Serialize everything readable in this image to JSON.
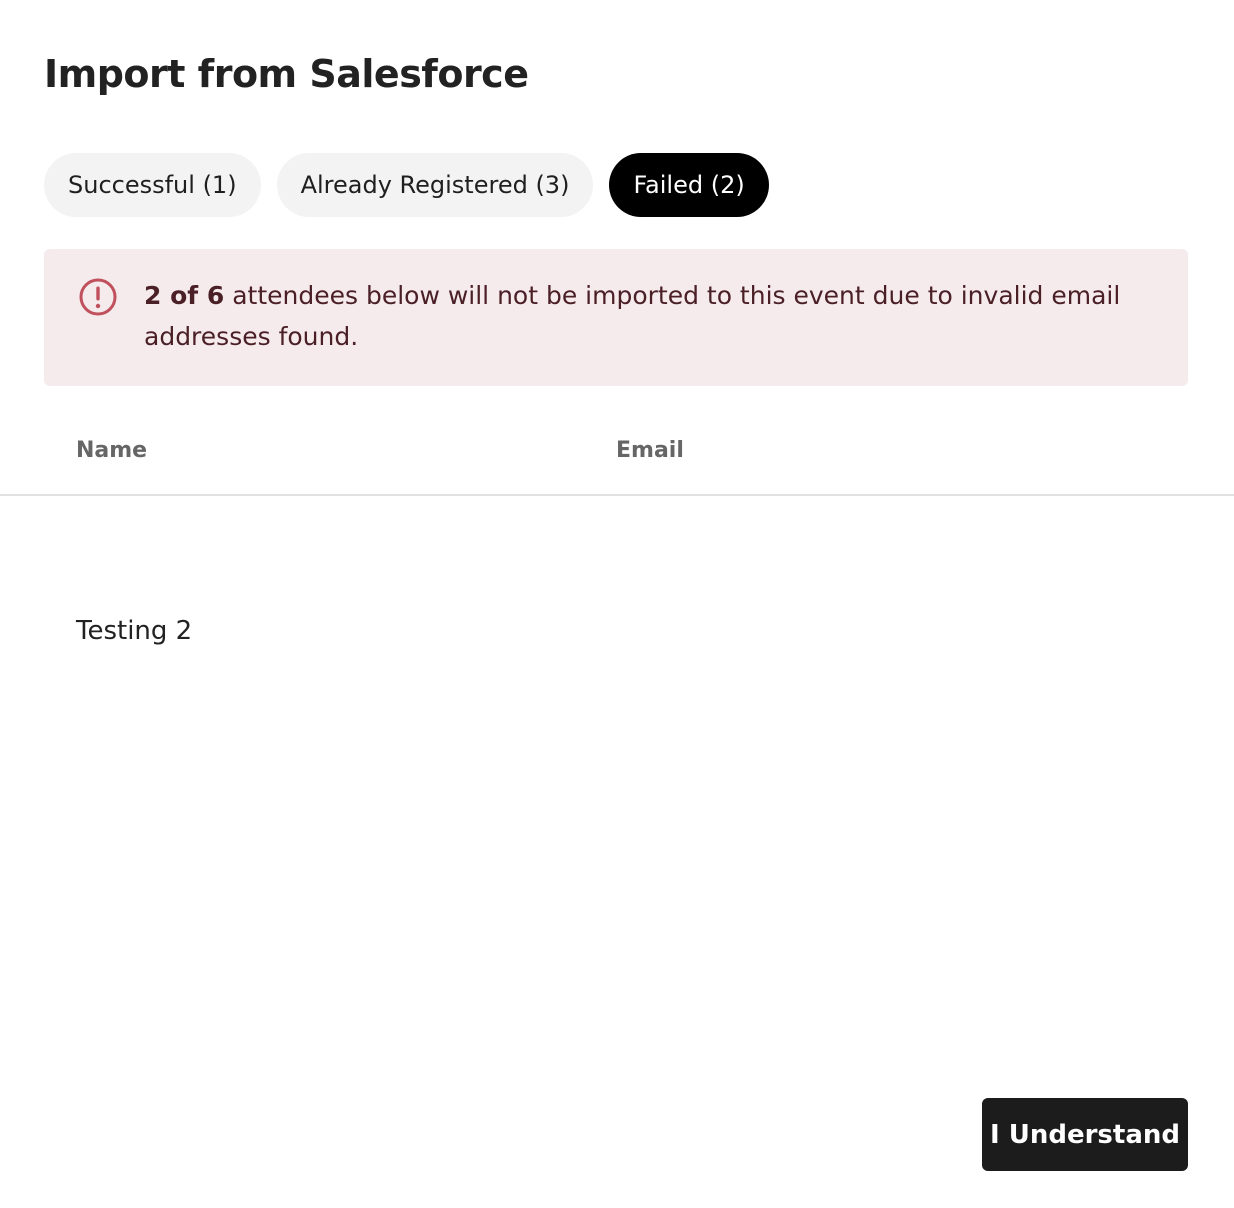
{
  "modal": {
    "title": "Import from Salesforce"
  },
  "tabs": [
    {
      "label": "Successful (1)",
      "active": false
    },
    {
      "label": "Already Registered (3)",
      "active": false
    },
    {
      "label": "Failed (2)",
      "active": true
    }
  ],
  "alert": {
    "icon": "alert-circle-icon",
    "strong": "2 of 6",
    "message": " attendees below will not be imported to this event due to invalid email addresses found.",
    "color": "#c0505c",
    "background": "#f5eaec"
  },
  "table": {
    "headers": {
      "name": "Name",
      "email": "Email"
    },
    "rows": [
      {
        "name": "Testing 2",
        "email": ""
      }
    ]
  },
  "footer": {
    "confirm_label": "I Understand"
  }
}
